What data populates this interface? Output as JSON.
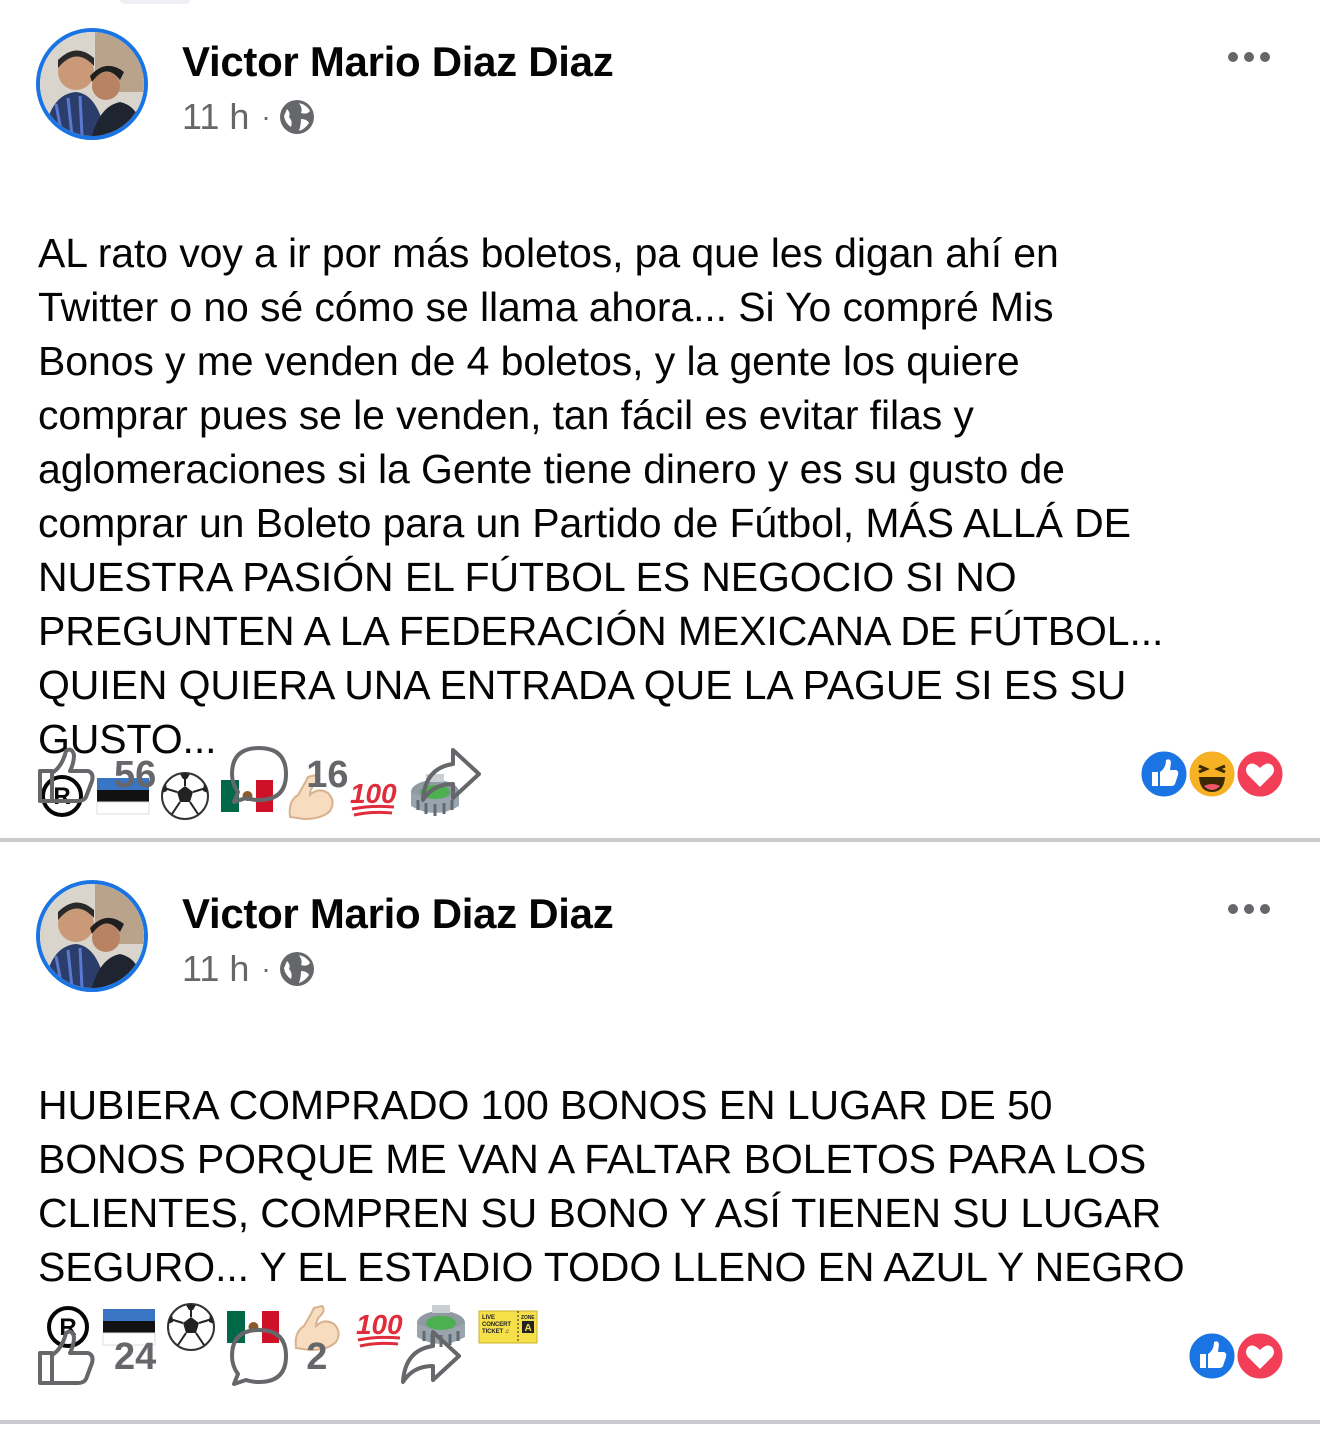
{
  "posts": [
    {
      "author": "Victor Mario Diaz Diaz",
      "time": "11 h",
      "separator": "·",
      "privacy_icon": "globe-icon",
      "text": "AL rato voy a ir por más boletos, pa que les digan ahí en\nTwitter o no sé cómo se llama ahora... Si Yo compré Mis\nBonos y me venden de 4 boletos, y la gente los quiere\ncomprar pues se le venden, tan fácil es evitar filas y\naglomeraciones si la Gente tiene dinero y es su gusto de\ncomprar un Boleto para un Partido de Fútbol, MÁS ALLÁ DE\nNUESTRA PASIÓN EL FÚTBOL ES NEGOCIO SI NO\nPREGUNTEN A LA FEDERACIÓN MEXICANA DE FÚTBOL...\nQUIEN QUIERA UNA ENTRADA QUE LA PAGUE SI ES SU\nGUSTO...",
      "emojis": [
        "registered",
        "estonia-flag",
        "soccer-ball",
        "mexico-flag",
        "flexed-biceps",
        "hundred-points",
        "stadium"
      ],
      "likes": "56",
      "comments": "16",
      "reactions": [
        "like",
        "haha",
        "love"
      ]
    },
    {
      "author": "Victor Mario Diaz Diaz",
      "time": "11 h",
      "separator": "·",
      "privacy_icon": "globe-icon",
      "text": "HUBIERA COMPRADO 100 BONOS EN LUGAR DE 50\nBONOS PORQUE ME VAN A FALTAR BOLETOS PARA LOS\nCLIENTES, COMPREN SU BONO Y ASÍ TIENEN SU LUGAR\nSEGURO... Y EL ESTADIO TODO LLENO EN AZUL Y NEGRO",
      "emojis": [
        "registered",
        "estonia-flag",
        "soccer-ball",
        "mexico-flag",
        "flexed-biceps",
        "hundred-points",
        "stadium",
        "ticket"
      ],
      "ticket_text": {
        "line1": "LIVE",
        "line2": "CONCERT",
        "line3": "TICKET ♫",
        "zone": "ZONE",
        "zone_letter": "A"
      },
      "likes": "24",
      "comments": "2",
      "reactions": [
        "like",
        "love"
      ]
    }
  ],
  "colors": {
    "accent": "#1b74e4",
    "secondary_text": "#65676b",
    "love": "#f33e58",
    "haha": "#f7b125",
    "divider": "#c8cacd"
  }
}
